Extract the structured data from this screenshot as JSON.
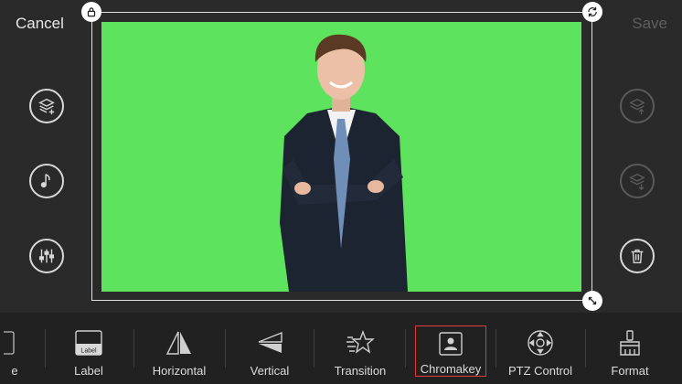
{
  "header": {
    "cancel_label": "Cancel",
    "save_label": "Save"
  },
  "left_actions": [
    {
      "icon": "add-layer-icon"
    },
    {
      "icon": "music-note-icon"
    },
    {
      "icon": "audio-mixer-icon"
    }
  ],
  "right_actions": [
    {
      "icon": "layer-up-icon",
      "enabled": false
    },
    {
      "icon": "layer-down-icon",
      "enabled": false
    },
    {
      "icon": "trash-icon",
      "enabled": true
    }
  ],
  "toolbar": {
    "partial_label": "e",
    "items": [
      {
        "label": "Label",
        "icon": "label-icon",
        "icon_text": "Label"
      },
      {
        "label": "Horizontal",
        "icon": "flip-horizontal-icon"
      },
      {
        "label": "Vertical",
        "icon": "flip-vertical-icon"
      },
      {
        "label": "Transition",
        "icon": "transition-star-icon"
      },
      {
        "label": "Chromakey",
        "icon": "chromakey-icon",
        "selected": true
      },
      {
        "label": "PTZ Control",
        "icon": "ptz-control-icon"
      },
      {
        "label": "Format",
        "icon": "format-brush-icon"
      }
    ]
  },
  "colors": {
    "chroma_green": "#5ee35e",
    "selection_red": "#e03a3a"
  }
}
